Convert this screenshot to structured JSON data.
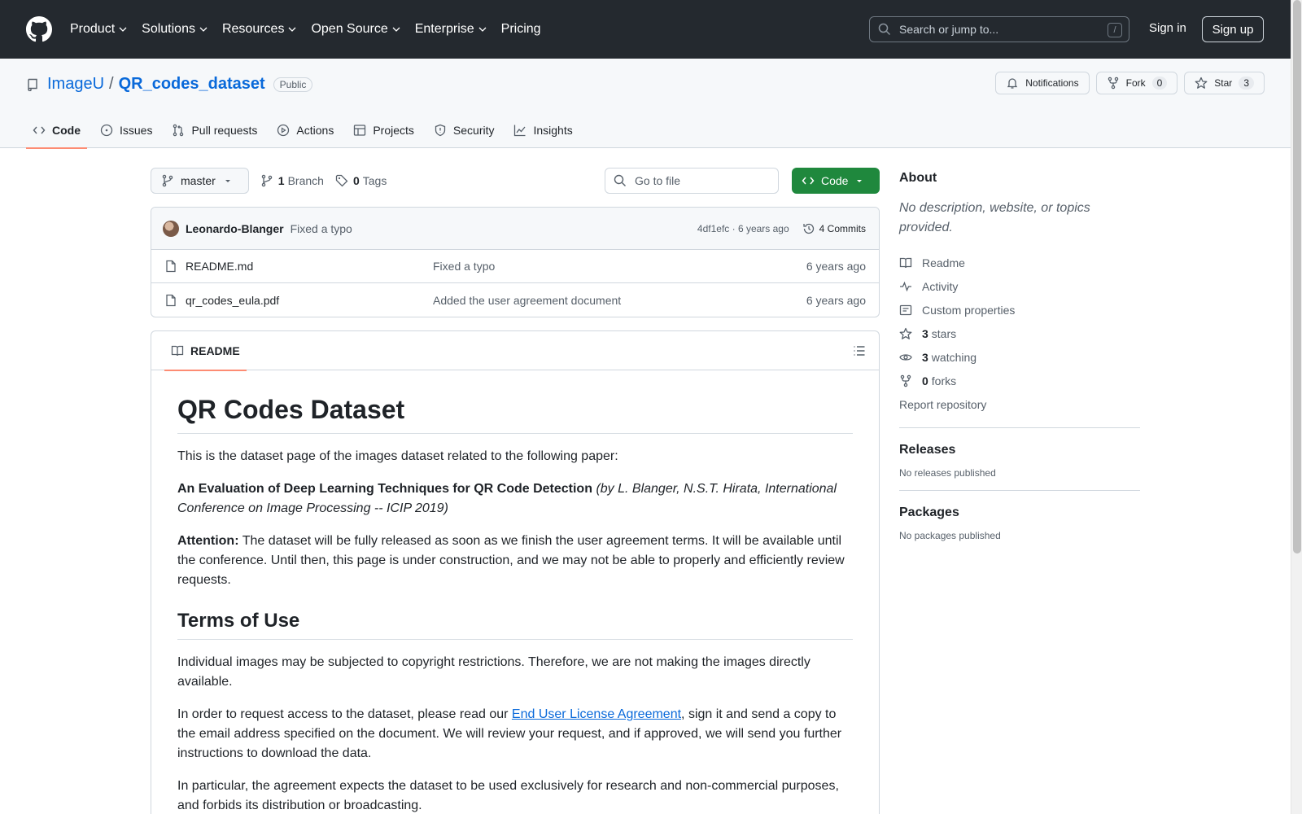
{
  "header": {
    "nav": [
      "Product",
      "Solutions",
      "Resources",
      "Open Source",
      "Enterprise",
      "Pricing"
    ],
    "search_placeholder": "Search or jump to...",
    "search_key": "/",
    "sign_in": "Sign in",
    "sign_up": "Sign up"
  },
  "repo": {
    "owner": "ImageU",
    "separator": "/",
    "name": "QR_codes_dataset",
    "visibility": "Public",
    "notifications_label": "Notifications",
    "fork_label": "Fork",
    "fork_count": "0",
    "star_label": "Star",
    "star_count": "3"
  },
  "tabs": [
    "Code",
    "Issues",
    "Pull requests",
    "Actions",
    "Projects",
    "Security",
    "Insights"
  ],
  "toolbar": {
    "branch": "master",
    "branch_count": "1",
    "branch_label": "Branch",
    "tag_count": "0",
    "tag_label": "Tags",
    "goto_placeholder": "Go to file",
    "code_label": "Code"
  },
  "commit": {
    "author": "Leonardo-Blanger",
    "message": "Fixed a typo",
    "meta": "4df1efc · 6 years ago",
    "commits": "4 Commits"
  },
  "files": [
    {
      "name": "README.md",
      "message": "Fixed a typo",
      "date": "6 years ago"
    },
    {
      "name": "qr_codes_eula.pdf",
      "message": "Added the user agreement document",
      "date": "6 years ago"
    }
  ],
  "readme": {
    "tab": "README",
    "title": "QR Codes Dataset",
    "p1": "This is the dataset page of the images dataset related to the following paper:",
    "paper_title": "An Evaluation of Deep Learning Techniques for QR Code Detection",
    "paper_authors": "(by L. Blanger, N.S.T. Hirata, International Conference on Image Processing -- ICIP 2019)",
    "attention_label": "Attention:",
    "attention_text": "The dataset will be fully released as soon as we finish the user agreement terms. It will be available until the conference. Until then, this page is under construction, and we may not be able to properly and efficiently review requests.",
    "terms_title": "Terms of Use",
    "terms_p1": "Individual images may be subjected to copyright restrictions. Therefore, we are not making the images directly available.",
    "terms_p2_a": "In order to request access to the dataset, please read our",
    "terms_p2_link": "End User License Agreement",
    "terms_p2_b": ", sign it and send a copy to the email address specified on the document. We will review your request, and if approved, we will send you further instructions to download the data.",
    "terms_p3": "In particular, the agreement expects the dataset to be used exclusively for research and non-commercial purposes, and forbids its distribution or broadcasting."
  },
  "sidebar": {
    "about": "About",
    "description": "No description, website, or topics provided.",
    "readme": "Readme",
    "activity": "Activity",
    "custom_properties": "Custom properties",
    "stars_count": "3",
    "stars_label": "stars",
    "watching_count": "3",
    "watching_label": "watching",
    "forks_count": "0",
    "forks_label": "forks",
    "report": "Report repository",
    "releases": "Releases",
    "no_releases": "No releases published",
    "packages": "Packages",
    "no_packages": "No packages published"
  }
}
